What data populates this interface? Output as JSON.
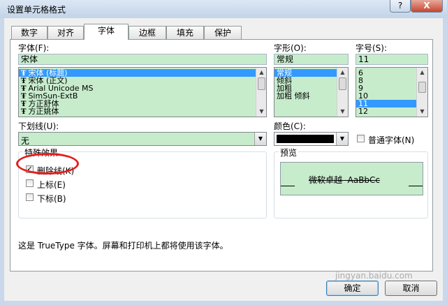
{
  "window": {
    "title": "设置单元格格式",
    "help": "?",
    "close": "X"
  },
  "tabs": [
    {
      "label": "数字",
      "active": false
    },
    {
      "label": "对齐",
      "active": false
    },
    {
      "label": "字体",
      "active": true
    },
    {
      "label": "边框",
      "active": false
    },
    {
      "label": "填充",
      "active": false
    },
    {
      "label": "保护",
      "active": false
    }
  ],
  "font": {
    "label": "字体(F):",
    "value": "宋体",
    "tt_glyph": "Ŧ",
    "items": [
      {
        "text": "宋体 (标题)",
        "selected": true
      },
      {
        "text": "宋体 (正文)",
        "selected": false
      },
      {
        "text": "Arial Unicode MS",
        "selected": false
      },
      {
        "text": "SimSun-ExtB",
        "selected": false
      },
      {
        "text": "方正舒体",
        "selected": false
      },
      {
        "text": "方正姚体",
        "selected": false
      }
    ]
  },
  "style": {
    "label": "字形(O):",
    "value": "常规",
    "items": [
      {
        "text": "常规",
        "selected": true
      },
      {
        "text": "倾斜",
        "selected": false
      },
      {
        "text": "加粗",
        "selected": false
      },
      {
        "text": "加粗 倾斜",
        "selected": false
      }
    ]
  },
  "size": {
    "label": "字号(S):",
    "value": "11",
    "items": [
      {
        "text": "6",
        "selected": false
      },
      {
        "text": "8",
        "selected": false
      },
      {
        "text": "9",
        "selected": false
      },
      {
        "text": "10",
        "selected": false
      },
      {
        "text": "11",
        "selected": true
      },
      {
        "text": "12",
        "selected": false
      }
    ]
  },
  "underline": {
    "label": "下划线(U):",
    "value": "无"
  },
  "color": {
    "label": "颜色(C):",
    "swatch": "#000000",
    "normal_font_label": "普通字体(N)"
  },
  "effects": {
    "title": "特殊效果",
    "strikethrough": {
      "label": "删除线(K)",
      "checked": true,
      "check_glyph": "✓"
    },
    "superscript": {
      "label": "上标(E)",
      "checked": false
    },
    "subscript": {
      "label": "下标(B)",
      "checked": false
    }
  },
  "preview": {
    "title": "预览",
    "sample": "微软卓越  AaBbCc"
  },
  "info": "这是 TrueType 字体。屏幕和打印机上都将使用该字体。",
  "buttons": {
    "ok": "确定",
    "cancel": "取消"
  },
  "watermark": "jingyan.baidu.com",
  "colors": {
    "field_bg": "#c7eccc",
    "selection": "#3399ff",
    "annotation": "#e41f1f"
  }
}
